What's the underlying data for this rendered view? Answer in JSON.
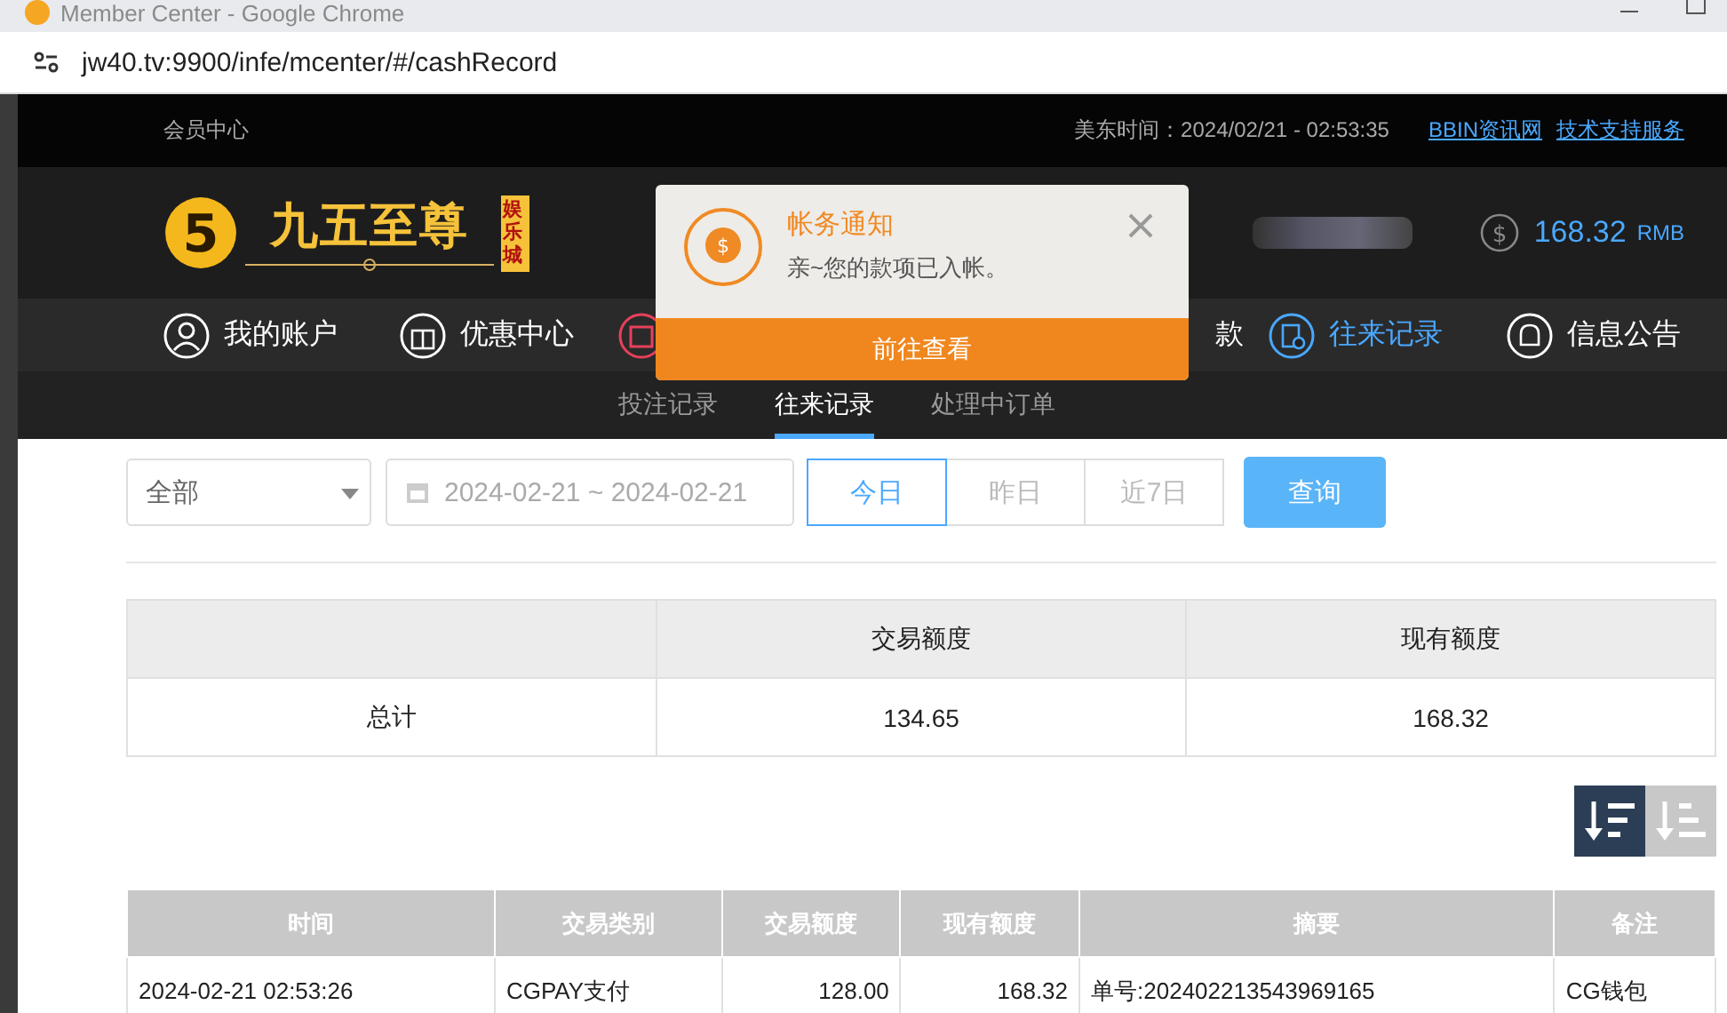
{
  "window": {
    "title": "Member Center - Google Chrome",
    "url": "jw40.tv:9900/infe/mcenter/#/cashRecord"
  },
  "top_bar": {
    "title": "会员中心",
    "time_label": "美东时间：2024/02/21 - 02:53:35",
    "links": [
      "BBIN资讯网",
      "技术支持服务"
    ]
  },
  "header": {
    "logo_mark": "5",
    "logo_text": "九五至尊",
    "logo_tag": "娱乐城",
    "balance_icon": "$",
    "balance": "168.32",
    "currency": "RMB"
  },
  "nav": [
    {
      "label": "我的账户",
      "kind": "user",
      "selected": false
    },
    {
      "label": "优惠中心",
      "kind": "gift",
      "selected": false
    },
    {
      "kind": "cashier",
      "selected": false
    },
    {
      "label": "款",
      "kind": "withdraw",
      "selected": false
    },
    {
      "label": "往来记录",
      "kind": "record",
      "selected": true
    },
    {
      "label": "信息公告",
      "kind": "bell",
      "selected": false
    }
  ],
  "sub_tabs": [
    {
      "label": "投注记录",
      "selected": false
    },
    {
      "label": "往来记录",
      "selected": true
    },
    {
      "label": "处理中订单",
      "selected": false
    }
  ],
  "filters": {
    "type_select": "全部",
    "date_range": "2024-02-21 ~ 2024-02-21",
    "quick_ranges": [
      {
        "label": "今日",
        "selected": true
      },
      {
        "label": "昨日",
        "selected": false
      },
      {
        "label": "近7日",
        "selected": false
      }
    ],
    "query_button": "查询"
  },
  "summary": {
    "columns": [
      "交易额度",
      "现有额度"
    ],
    "row_label": "总计",
    "values": [
      "134.65",
      "168.32"
    ]
  },
  "sort_buttons": [
    {
      "kind": "desc",
      "selected": true
    },
    {
      "kind": "asc",
      "selected": false
    }
  ],
  "table": {
    "columns": [
      "时间",
      "交易类别",
      "交易额度",
      "现有额度",
      "摘要",
      "备注"
    ],
    "rows": [
      [
        "2024-02-21 02:53:26",
        "CGPAY支付",
        "128.00",
        "168.32",
        "单号:202402213543969165",
        "CG钱包"
      ]
    ]
  },
  "notification": {
    "icon": "$",
    "title": "帐务通知",
    "message": "亲~您的款项已入帐。",
    "button": "前往查看"
  }
}
